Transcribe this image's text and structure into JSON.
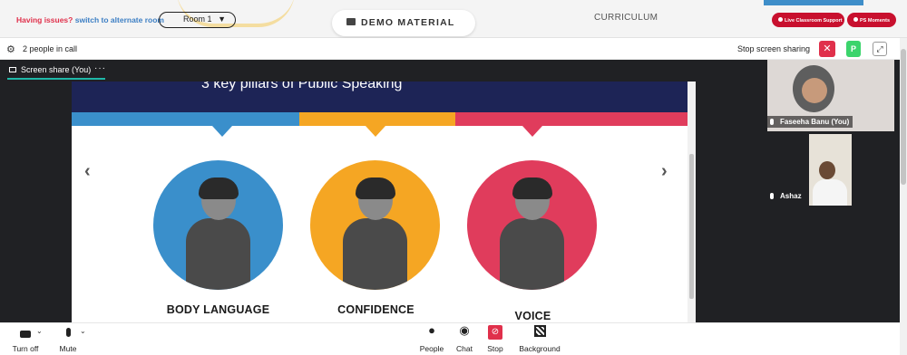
{
  "topbar": {
    "issues_question": "Having issues?",
    "issues_link": "switch to alternate room",
    "room_selector": "Room 1",
    "demo_material": "DEMO MATERIAL",
    "curriculum": "CURRICULUM",
    "live_support": "Live Classroom Support",
    "ps_moments": "PS Moments"
  },
  "callbar": {
    "people_count": "2 people in call",
    "stop_sharing": "Stop screen sharing",
    "participant_initial": "P"
  },
  "stage": {
    "tab_label": "Screen share (You)",
    "tab_more": "···"
  },
  "slide": {
    "title": "3 key pillars of Public Speaking",
    "pillars": [
      {
        "label": "BODY LANGUAGE",
        "color": "#3a8fcb"
      },
      {
        "label": "CONFIDENCE",
        "color": "#f5a623"
      },
      {
        "label": "VOICE",
        "color": "#e03c5c"
      }
    ],
    "prev_arrow": "‹",
    "next_arrow": "›"
  },
  "participants": [
    {
      "name": "Faseeha Banu (You)"
    },
    {
      "name": "Ashaz"
    }
  ],
  "bottombar": {
    "turn_off": "Turn off",
    "mute": "Mute",
    "people": "People",
    "chat": "Chat",
    "stop": "Stop",
    "background": "Background"
  },
  "colors": {
    "accent_red": "#e0304b",
    "slide_navy": "#1d2456",
    "teal_underline": "#1fb8a8"
  }
}
